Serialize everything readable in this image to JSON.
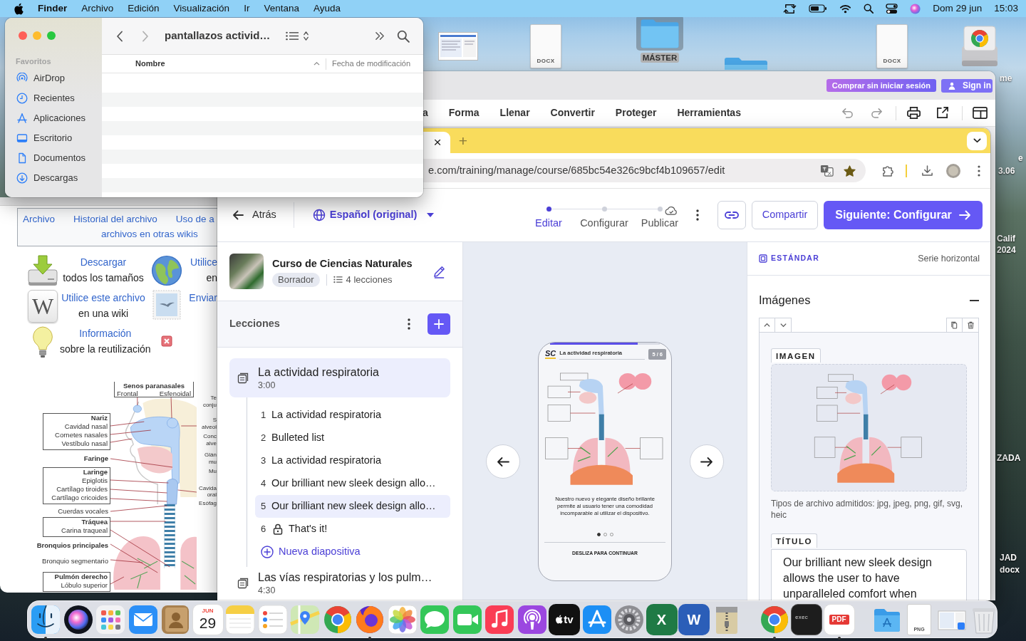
{
  "menu_bar": {
    "app_name": "Finder",
    "menus": [
      "Archivo",
      "Edición",
      "Visualización",
      "Ir",
      "Ventana",
      "Ayuda"
    ],
    "date": "Dom 29 jun",
    "time": "15:03"
  },
  "desktop": {
    "icons": [
      {
        "kind": "screenshot",
        "selected": false
      },
      {
        "kind": "document",
        "badge": "DOCX",
        "selected": false
      },
      {
        "kind": "folder",
        "label": "MÁSTER",
        "selected": true
      },
      {
        "kind": "folder",
        "selected": false
      },
      {
        "kind": "document",
        "badge": "DOCX",
        "selected": false
      },
      {
        "kind": "drive",
        "selected": false
      }
    ],
    "edge_labels": [
      "me",
      "e",
      "3.06",
      "Calif",
      "2024",
      "ZADA",
      "JAD",
      "docx"
    ]
  },
  "finder": {
    "title": "pantallazos activid…",
    "sidebar_heading": "Favoritos",
    "sidebar_items": [
      {
        "kind": "airdrop",
        "label": "AirDrop"
      },
      {
        "kind": "recents",
        "label": "Recientes"
      },
      {
        "kind": "applications",
        "label": "Aplicaciones"
      },
      {
        "kind": "desktop",
        "label": "Escritorio"
      },
      {
        "kind": "documents",
        "label": "Documentos"
      },
      {
        "kind": "downloads",
        "label": "Descargas"
      }
    ],
    "columns": [
      "Nombre",
      "Fecha de modificación"
    ]
  },
  "wiki": {
    "nav_rows": [
      [
        "Archivo",
        "Historial del archivo",
        "Uso de a"
      ],
      [
        "archivos en otras wikis"
      ]
    ],
    "actions": [
      {
        "kind": "download",
        "link": "Descargar",
        "text": "todos los tamaños"
      },
      {
        "kind": "globe",
        "link": "Utilice",
        "text": "en"
      },
      {
        "kind": "wiki",
        "logo": "W",
        "link": "Utilice este archivo",
        "text": "en una wiki"
      },
      {
        "kind": "stamp",
        "link": "Enviar"
      },
      {
        "kind": "bulb",
        "link": "Información",
        "text": "sobre la reutilización"
      },
      {
        "kind": "remove"
      }
    ],
    "diagram": {
      "top_group": {
        "title": "Senos paranasales",
        "items": [
          "Frontal",
          "Esfenoidal"
        ]
      },
      "left_labels": [
        {
          "kind": "group",
          "title": "Nariz",
          "items": [
            "Cavidad nasal",
            "Cornetes nasales",
            "Vestíbulo nasal"
          ]
        },
        {
          "kind": "bold",
          "text": "Faringe"
        },
        {
          "kind": "group",
          "title": "Laringe",
          "items": [
            "Epiglotis",
            "Cartílago tiroides",
            "Cartílago cricoides"
          ]
        },
        {
          "kind": "plain",
          "text": "Cuerdas vocales"
        },
        {
          "kind": "group",
          "title": "Tráquea",
          "items": [
            "Carina traqueal"
          ]
        },
        {
          "kind": "bold",
          "text": "Bronquios principales"
        },
        {
          "kind": "plain",
          "text": "Bronquio segmentario"
        },
        {
          "kind": "group",
          "title": "Pulmón derecho",
          "items": [
            "Lóbulo superior"
          ]
        }
      ],
      "right_labels": [
        [
          "Te",
          "conju"
        ],
        [
          "S",
          "alveol"
        ],
        [
          "Conc",
          "alve"
        ],
        [
          "Glán",
          "mu"
        ],
        [
          "Mu"
        ],
        [
          "Cavida",
          "oral"
        ],
        [
          "Esófag"
        ]
      ]
    }
  },
  "pdf_editor": {
    "buy_button": "Comprar sin iniciar sesión",
    "sign_in_button": "Sign in",
    "menu": [
      "a",
      "Forma",
      "Llenar",
      "Convertir",
      "Proteger",
      "Herramientas"
    ]
  },
  "browser": {
    "close_tab": "×",
    "new_tab": "+",
    "url": "e.com/training/manage/course/685bc54e326c9bcf4b109657/edit",
    "bookmarked": true
  },
  "course_editor": {
    "back": "Atrás",
    "language": "Español (original)",
    "steps": [
      {
        "label": "Editar",
        "selected": true
      },
      {
        "label": "Configurar",
        "selected": false
      },
      {
        "label": "Publicar",
        "selected": false
      }
    ],
    "share_button": "Compartir",
    "next_button": "Siguiente: Configurar",
    "course": {
      "title": "Curso de Ciencias Naturales",
      "status": "Borrador",
      "lesson_count": "4 lecciones"
    },
    "lessons_heading": "Lecciones",
    "lessons": [
      {
        "title": "La actividad respiratoria",
        "duration": "3:00",
        "selected": true,
        "slides": [
          {
            "number": "1",
            "title": "La actividad respiratoria",
            "locked": false,
            "selected": false
          },
          {
            "number": "2",
            "title": "Bulleted list",
            "locked": false,
            "selected": false
          },
          {
            "number": "3",
            "title": "La actividad respiratoria",
            "locked": false,
            "selected": false
          },
          {
            "number": "4",
            "title": "Our brilliant new sleek design allo…",
            "locked": false,
            "selected": false
          },
          {
            "number": "5",
            "title": "Our brilliant new sleek design allo…",
            "locked": false,
            "selected": true
          },
          {
            "number": "6",
            "title": "That's it!",
            "locked": true,
            "selected": false
          }
        ],
        "new_slide": "Nueva diapositiva"
      },
      {
        "title": "Las vías respiratorias y los pulm…",
        "duration": "4:30",
        "selected": false
      }
    ],
    "preview": {
      "logo": "SC",
      "title": "La actividad respiratoria",
      "counter": "5 / 6",
      "level": 0.8,
      "caption": "Nuestro nuevo y elegante diseño brillante permite al usuario tener una comodidad incomparable al utilizar el dispositivo.",
      "dots": [
        {
          "selected": true
        },
        {
          "selected": false
        },
        {
          "selected": false
        }
      ],
      "footer": "DESLIZA PARA CONTINUAR"
    },
    "properties": {
      "block_type": "ESTÁNDAR",
      "layout": "Serie horizontal",
      "section": "Imágenes",
      "image_label": "IMAGEN",
      "file_types": "Tipos de archivo admitidos: jpg, jpeg, png, gif, svg, heic",
      "title_label": "TÍTULO",
      "title_value": "Our brilliant new sleek design allows the user to have unparalleled comfort when"
    }
  },
  "dock": {
    "items": [
      {
        "kind": "face",
        "running": true
      },
      {
        "kind": "orb",
        "running": false
      },
      {
        "kind": "app_grid",
        "running": false
      },
      {
        "kind": "mail",
        "running": false
      },
      {
        "kind": "contacts",
        "running": false
      },
      {
        "kind": "calendar",
        "month": "JUN",
        "day": "29",
        "running": false
      },
      {
        "kind": "notes",
        "running": false
      },
      {
        "kind": "reminders",
        "running": false
      },
      {
        "kind": "map",
        "running": false
      },
      {
        "kind": "ring_browser",
        "running": false
      },
      {
        "kind": "fox_browser",
        "running": true
      },
      {
        "kind": "photos",
        "running": false
      },
      {
        "kind": "messages",
        "running": false
      },
      {
        "kind": "video_call",
        "running": false
      },
      {
        "kind": "music",
        "running": false
      },
      {
        "kind": "podcasts",
        "running": false
      },
      {
        "kind": "tv",
        "label": "tv",
        "running": false
      },
      {
        "kind": "app_store",
        "running": false
      },
      {
        "kind": "settings",
        "running": false
      },
      {
        "kind": "spreadsheet",
        "label": "X",
        "running": false
      },
      {
        "kind": "word_processor",
        "label": "W",
        "running": false
      },
      {
        "kind": "archive",
        "running": false
      },
      {
        "kind": "separator"
      },
      {
        "kind": "ring_browser",
        "running": true
      },
      {
        "kind": "terminal",
        "label": "exec",
        "running": false
      },
      {
        "kind": "pdf",
        "label": "PDF",
        "running": true
      },
      {
        "kind": "separator"
      },
      {
        "kind": "folder",
        "running": false
      },
      {
        "kind": "file",
        "label": "PNG",
        "running": false
      },
      {
        "kind": "screenshot",
        "running": false
      },
      {
        "kind": "trash",
        "running": false
      }
    ]
  }
}
